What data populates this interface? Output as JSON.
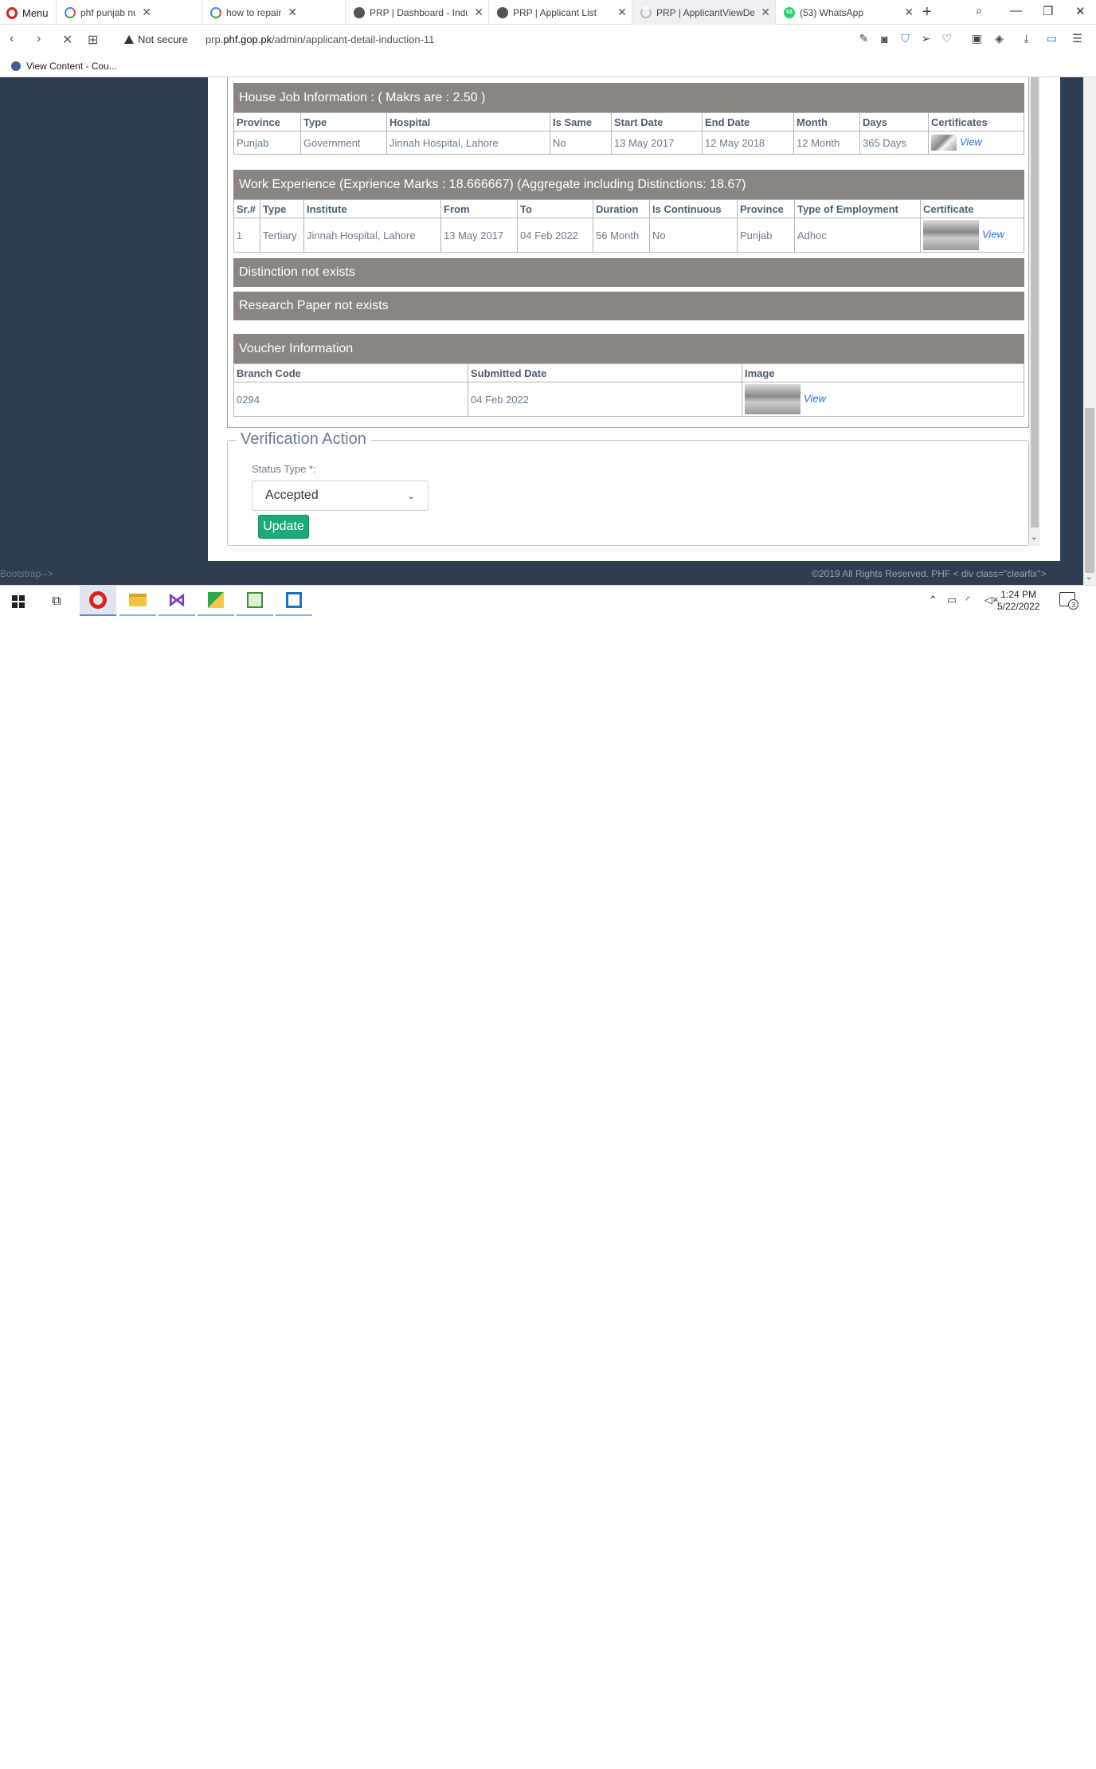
{
  "browser": {
    "menu_label": "Menu",
    "tabs": [
      {
        "title": "phf punjab nursing adm",
        "favicon": "google-icon"
      },
      {
        "title": "how to repair edmx mo",
        "favicon": "google-icon"
      },
      {
        "title": "PRP | Dashboard - Indu",
        "favicon": "globe-icon"
      },
      {
        "title": "PRP | Applicant List",
        "favicon": "globe-icon"
      },
      {
        "title": "PRP | ApplicantViewDe",
        "favicon": "loading-icon"
      },
      {
        "title": "(53) WhatsApp",
        "favicon": "whatsapp-icon",
        "badge": "53"
      }
    ],
    "security_label": "Not secure",
    "url_host_prefix": "prp.",
    "url_host_domain": "phf.gop.pk",
    "url_path": "/admin/applicant-detail-induction-11",
    "bookmark_label": "View Content - Cou..."
  },
  "house_job": {
    "title": "House Job Information : ( Makrs are : 2.50 )",
    "headers": [
      "Province",
      "Type",
      "Hospital",
      "Is Same",
      "Start Date",
      "End Date",
      "Month",
      "Days",
      "Certificates"
    ],
    "row": {
      "province": "Punjab",
      "type": "Government",
      "hospital": "Jinnah Hospital, Lahore",
      "is_same": "No",
      "start_date": "13 May 2017",
      "end_date": "12 May 2018",
      "month": "12 Month",
      "days": "365 Days",
      "link": "View"
    }
  },
  "work_experience": {
    "title": "Work Experience (Exprience Marks : 18.666667) (Aggregate including Distinctions: 18.67)",
    "headers": [
      "Sr.#",
      "Type",
      "Institute",
      "From",
      "To",
      "Duration",
      "Is Continuous",
      "Province",
      "Type of Employment",
      "Certificate"
    ],
    "row": {
      "sr": "1",
      "type": "Tertiary",
      "institute": "Jinnah Hospital, Lahore",
      "from": "13 May 2017",
      "to": "04 Feb 2022",
      "duration": "56 Month",
      "is_continuous": "No",
      "province": "Punjab",
      "employment": "Adhoc",
      "link": "View"
    }
  },
  "distinction_text": "Distinction not exists",
  "research_text": "Research Paper not exists",
  "voucher": {
    "title": "Voucher Information",
    "headers": [
      "Branch Code",
      "Submitted Date",
      "Image"
    ],
    "row": {
      "branch_code": "0294",
      "submitted_date": "04 Feb 2022",
      "link": "View"
    }
  },
  "verification": {
    "legend": "Verification Action",
    "status_label": "Status Type *:",
    "status_value": "Accepted",
    "update_label": "Update"
  },
  "footer": {
    "left_text": "Bootstrap-->",
    "copyright": "©2019 All Rights Reserved.",
    "brand": "PHF",
    "code_text": "< div class=\"clearfix\">"
  },
  "taskbar": {
    "time": "1:24 PM",
    "date": "5/22/2022",
    "notification_count": "3"
  }
}
